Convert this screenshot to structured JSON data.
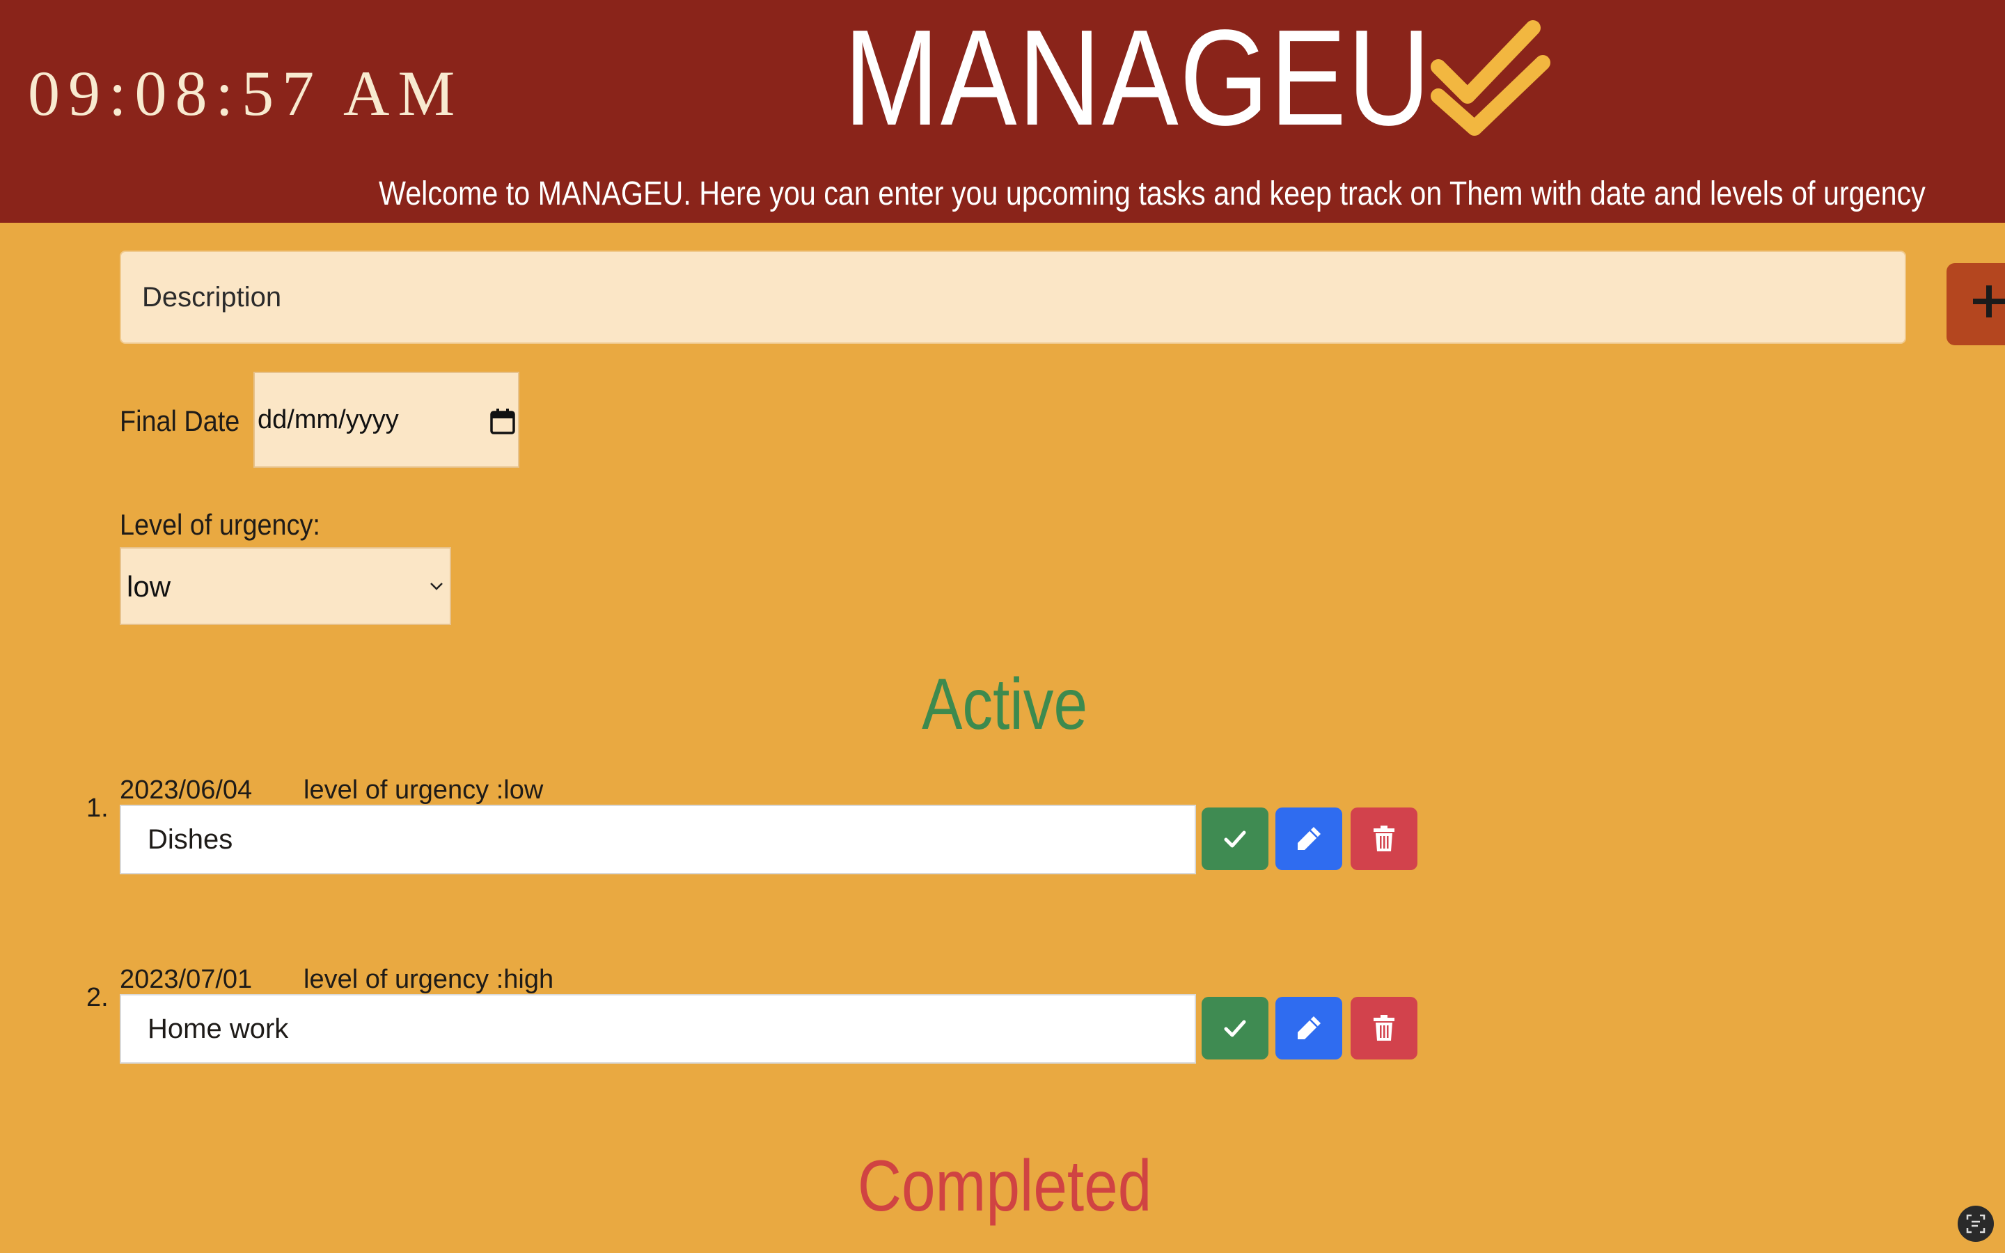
{
  "header": {
    "clock": "09:08:57 AM",
    "brand_title": "MANAGEU",
    "brand_icon": "double-check-icon",
    "marquee": "Welcome to MANAGEU. Here you can enter you upcoming tasks and keep track on Them with date and levels of urgency"
  },
  "form": {
    "description_placeholder": "Description",
    "add_icon": "plus-icon",
    "final_date_label": "Final Date",
    "final_date_value": "dd/mm/yyyy",
    "urgency_label": "Level of urgency:",
    "urgency_selected": "low"
  },
  "sections": {
    "active_title": "Active",
    "completed_title": "Completed"
  },
  "tasks": [
    {
      "number": "1.",
      "date": "2023/06/04",
      "urgency": "level of urgency :low",
      "text": "Dishes"
    },
    {
      "number": "2.",
      "date": "2023/07/01",
      "urgency": "level of urgency :high",
      "text": "Home work"
    }
  ],
  "colors": {
    "page_bg": "#e9a941",
    "header_bg": "#8a241a",
    "brand_check": "#f2b740",
    "active": "#3d8a4e",
    "completed": "#d04342",
    "done_btn": "#3f8b52",
    "edit_btn": "#2f6cf0",
    "delete_btn": "#d2424c",
    "add_btn": "#b4461f"
  }
}
